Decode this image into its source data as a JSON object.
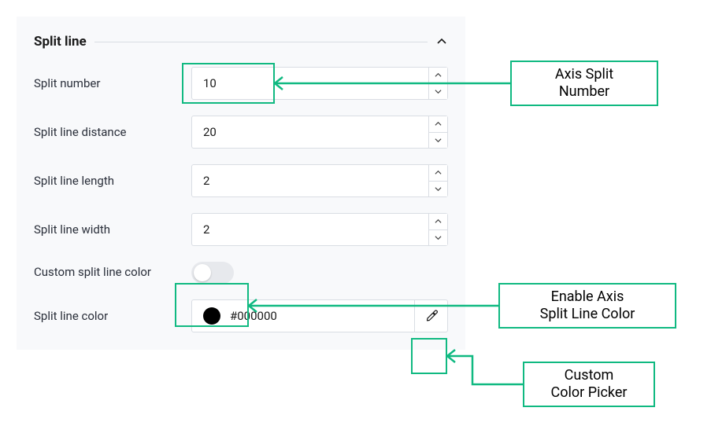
{
  "section": {
    "title": "Split line"
  },
  "fields": {
    "splitNumber": {
      "label": "Split number",
      "value": "10"
    },
    "splitDistance": {
      "label": "Split line distance",
      "value": "20"
    },
    "splitLength": {
      "label": "Split line length",
      "value": "2"
    },
    "splitWidth": {
      "label": "Split line width",
      "value": "2"
    },
    "customColor": {
      "label": "Custom split line color"
    },
    "lineColor": {
      "label": "Split line color",
      "value": "#000000",
      "swatch": "#000000"
    }
  },
  "callouts": {
    "axisSplitNumber": "Axis Split\nNumber",
    "enableColor": "Enable Axis\nSplit Line Color",
    "customPicker": "Custom\nColor Picker"
  },
  "colors": {
    "accent": "#10b981"
  }
}
